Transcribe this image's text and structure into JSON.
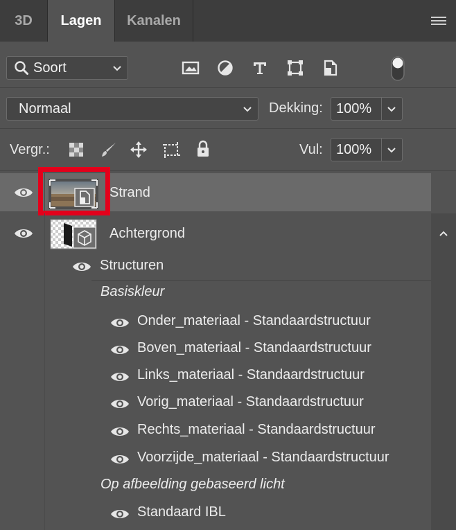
{
  "tabs": [
    {
      "label": "3D"
    },
    {
      "label": "Lagen"
    },
    {
      "label": "Kanalen"
    }
  ],
  "filter": {
    "kind_label": "Soort"
  },
  "blend": {
    "mode": "Normaal",
    "opacity_label": "Dekking:",
    "opacity_value": "100%"
  },
  "lock": {
    "label": "Vergr.:",
    "fill_label": "Vul:",
    "fill_value": "100%"
  },
  "layers": [
    {
      "name": "Strand",
      "selected": true
    },
    {
      "name": "Achtergrond"
    }
  ],
  "textures": {
    "group_label": "Structuren",
    "sections": [
      {
        "title": "Basiskleur",
        "items": [
          "Onder_materiaal - Standaardstructuur",
          "Boven_materiaal - Standaardstructuur",
          "Links_materiaal - Standaardstructuur",
          "Vorig_materiaal - Standaardstructuur",
          "Rechts_materiaal - Standaardstructuur",
          "Voorzijde_materiaal - Standaardstructuur"
        ]
      },
      {
        "title": "Op afbeelding gebaseerd licht",
        "items": [
          "Standaard IBL"
        ]
      }
    ]
  },
  "colors": {
    "highlight": "#e3001b",
    "selected_row": "#6a6a6a",
    "panel": "#535353"
  }
}
